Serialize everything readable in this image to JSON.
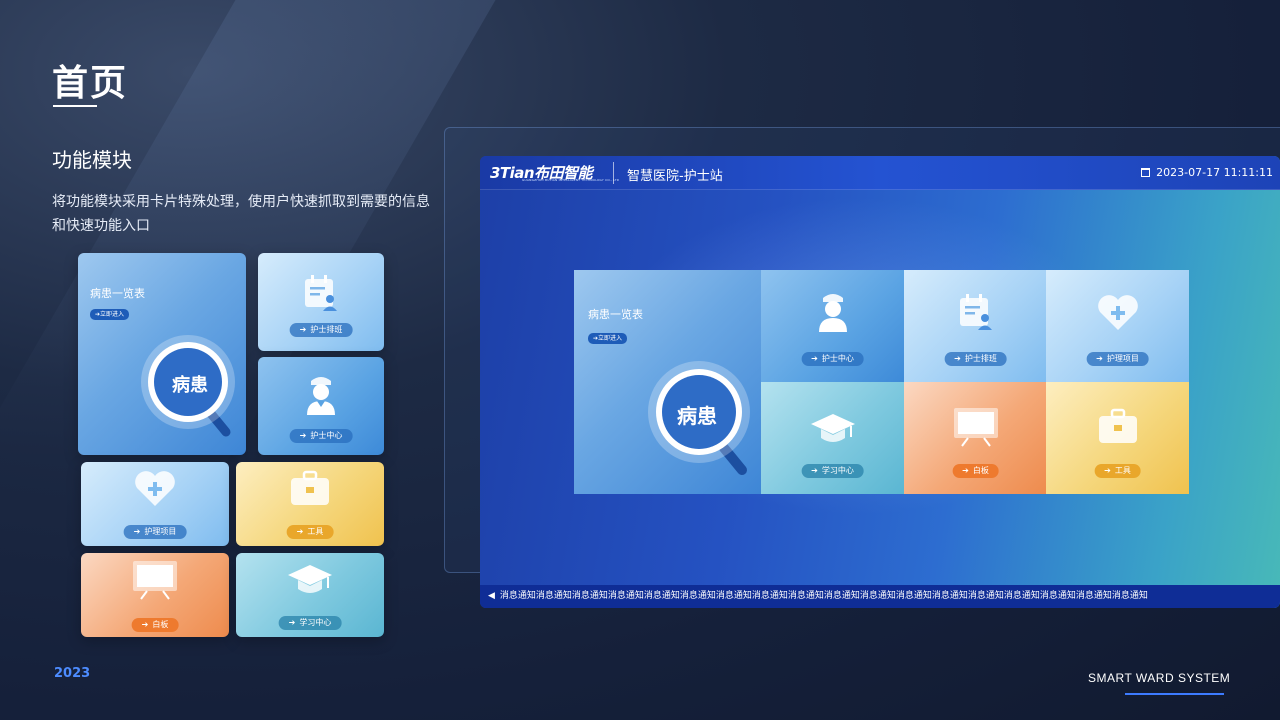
{
  "page": {
    "title": "首页",
    "section_title": "功能模块",
    "section_desc": "将功能模块采用卡片特殊处理，使用户快速抓取到需要的信息和快速功能入口",
    "year": "2023",
    "brand_footer": "SMART WARD SYSTEM"
  },
  "left_cards": {
    "patients": {
      "title": "病患一览表",
      "enter": "➔立即进入",
      "badge": "病患"
    },
    "schedule": {
      "label": "护士排班"
    },
    "nurse_center": {
      "label": "护士中心"
    },
    "nursing_items": {
      "label": "护理项目"
    },
    "tools": {
      "label": "工具"
    },
    "whiteboard": {
      "label": "白板"
    },
    "learning": {
      "label": "学习中心"
    }
  },
  "screen": {
    "logo_text": "3Tian布田智能",
    "logo_subtitle": "GUANGZHOU BUTIAN INTELLIGENT TECHNOLOGY CO., LTD",
    "station": "智慧医院-护士站",
    "datetime": "2023-07-17 11:11:11",
    "ticker": "消息通知消息通知消息通知消息通知消息通知消息通知消息通知消息通知消息通知消息通知消息通知消息通知消息通知消息通知消息通知消息通知消息通知消息通知",
    "tiles": {
      "patients": {
        "title": "病患一览表",
        "enter": "➔立即进入",
        "badge": "病患"
      },
      "nurse_center": {
        "label": "护士中心"
      },
      "schedule": {
        "label": "护士排班"
      },
      "nursing_items": {
        "label": "护理项目"
      },
      "learning": {
        "label": "学习中心"
      },
      "whiteboard": {
        "label": "白板"
      },
      "tools": {
        "label": "工具"
      }
    }
  },
  "arrow": "➔",
  "colors": {
    "accent_blue": "#3d7bff",
    "year_blue": "#4d8cff",
    "pill_orange": "#ee7a2e",
    "pill_gold": "#e9a72b"
  }
}
